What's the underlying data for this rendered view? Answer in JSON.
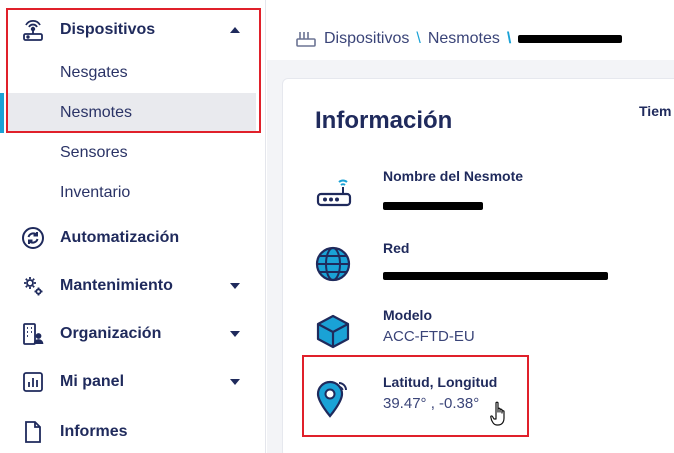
{
  "sidebar": {
    "devices": {
      "label": "Dispositivos",
      "icon": "router-antenna-icon",
      "expanded": true
    },
    "sub_items": [
      {
        "label": "Nesgates",
        "active": false
      },
      {
        "label": "Nesmotes",
        "active": true
      },
      {
        "label": "Sensores",
        "active": false
      },
      {
        "label": "Inventario",
        "active": false
      }
    ],
    "automation": {
      "label": "Automatización",
      "icon": "sync-icon"
    },
    "maintenance": {
      "label": "Mantenimiento",
      "icon": "gears-icon"
    },
    "organization": {
      "label": "Organización",
      "icon": "building-people-icon"
    },
    "dashboard": {
      "label": "Mi panel",
      "icon": "bar-chart-icon"
    },
    "reports": {
      "label": "Informes",
      "icon": "document-icon"
    }
  },
  "breadcrumb": {
    "root": "Dispositivos",
    "section": "Nesmotes",
    "separator": "\\"
  },
  "card": {
    "title": "Información",
    "side_title": "Tiem",
    "rows": [
      {
        "label": "Nombre del Nesmote",
        "value": "",
        "icon": "gateway-device-icon"
      },
      {
        "label": "Red",
        "value": "",
        "icon": "globe-icon"
      },
      {
        "label": "Modelo",
        "value": "ACC-FTD-EU",
        "icon": "cube-icon"
      },
      {
        "label": "Latitud, Longitud",
        "value": "39.47° , -0.38°",
        "icon": "location-pin-icon"
      }
    ]
  },
  "colors": {
    "accent": "#1aa2d6",
    "primary_text": "#1f2a5c",
    "highlight_border": "#e0202a"
  }
}
